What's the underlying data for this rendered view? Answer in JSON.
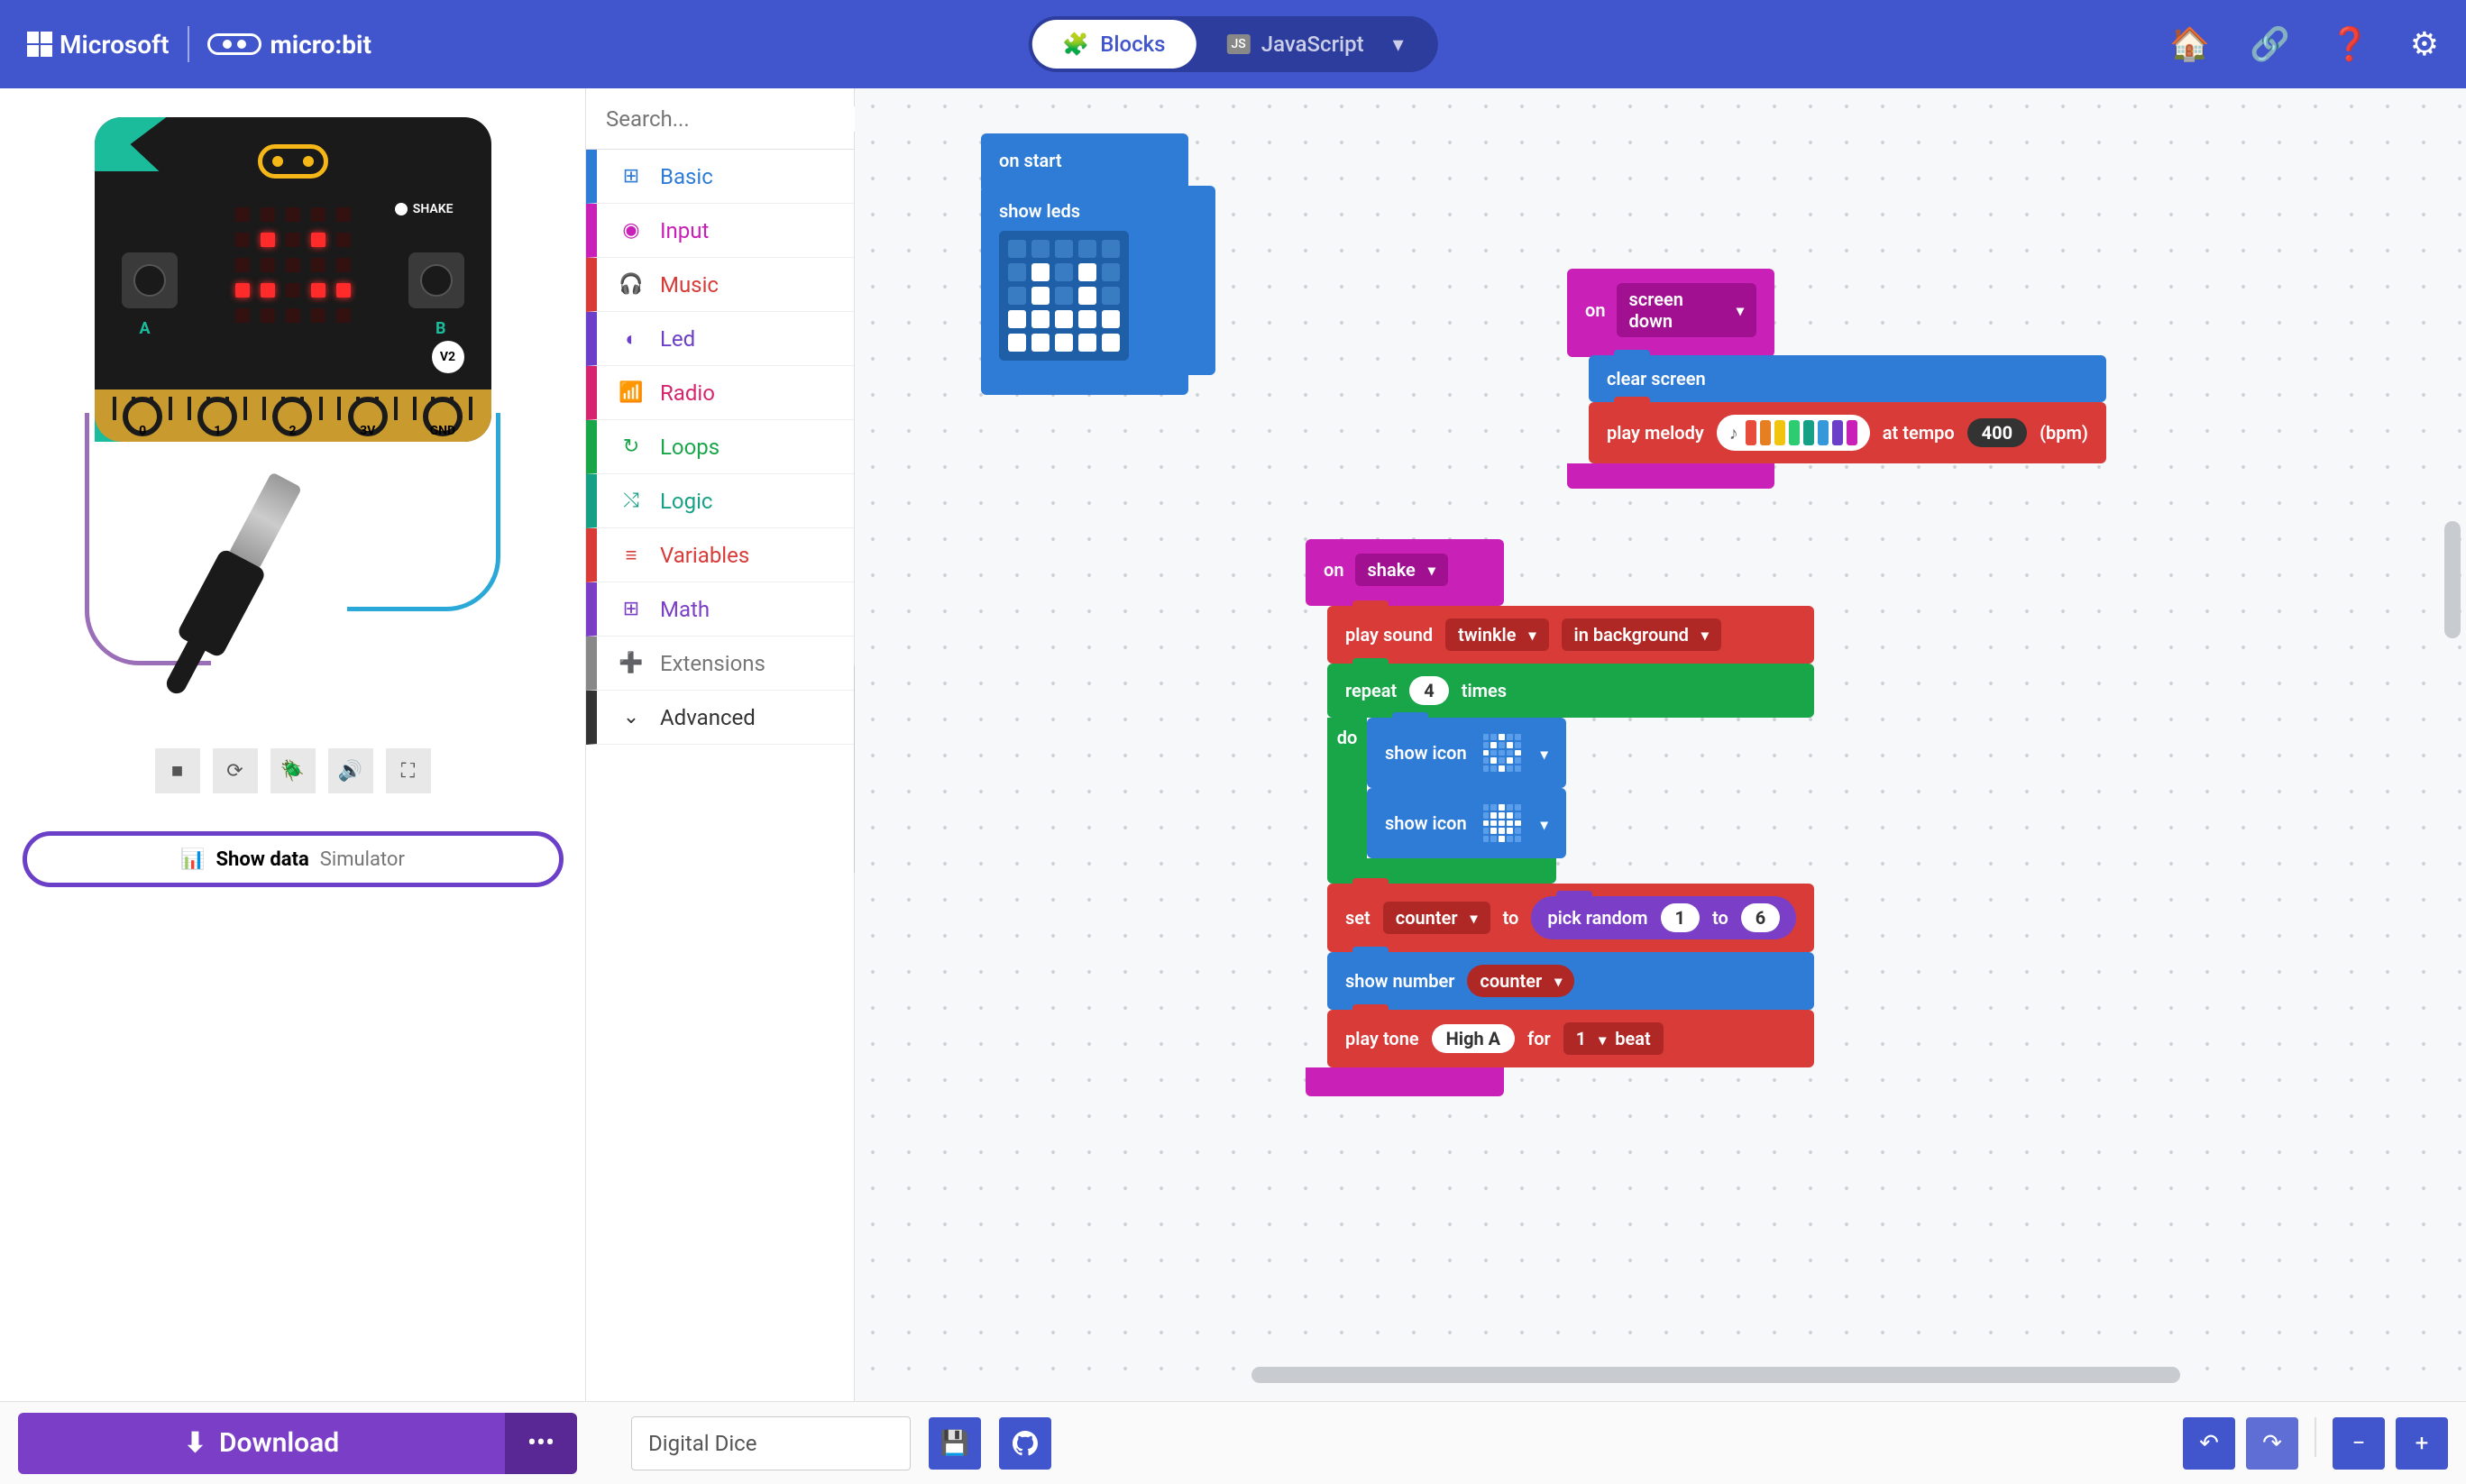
{
  "header": {
    "ms": "Microsoft",
    "mb": "micro:bit",
    "blocks": "Blocks",
    "js": "JavaScript"
  },
  "toolbox": {
    "search_placeholder": "Search...",
    "categories": [
      {
        "label": "Basic",
        "color": "#2e7cd6",
        "text": "#2e7cd6",
        "icon": "⊞"
      },
      {
        "label": "Input",
        "color": "#c920b7",
        "text": "#c920b7",
        "icon": "◉"
      },
      {
        "label": "Music",
        "color": "#d83b38",
        "text": "#d83b38",
        "icon": "🎧"
      },
      {
        "label": "Led",
        "color": "#6b3fc7",
        "text": "#6b3fc7",
        "icon": "◐"
      },
      {
        "label": "Radio",
        "color": "#d6246f",
        "text": "#d6246f",
        "icon": "📶"
      },
      {
        "label": "Loops",
        "color": "#19a649",
        "text": "#19a649",
        "icon": "↻"
      },
      {
        "label": "Logic",
        "color": "#16a085",
        "text": "#16a085",
        "icon": "⤭"
      },
      {
        "label": "Variables",
        "color": "#d83b38",
        "text": "#d83b38",
        "icon": "≡"
      },
      {
        "label": "Math",
        "color": "#7b3fc7",
        "text": "#7b3fc7",
        "icon": "⊞"
      },
      {
        "label": "Extensions",
        "color": "#888",
        "text": "#777",
        "icon": "➕"
      }
    ],
    "advanced": "Advanced"
  },
  "simulator": {
    "shake_label": "SHAKE",
    "v2": "V2",
    "pins": [
      "0",
      "1",
      "2",
      "3V",
      "GND"
    ],
    "show_data_bold": "Show data",
    "show_data_light": "Simulator"
  },
  "blocks": {
    "on_start": "on start",
    "show_leds": "show leds",
    "on_screen_down": "on",
    "screen_down": "screen down",
    "clear_screen": "clear screen",
    "play_melody": "play melody",
    "at_tempo": "at tempo",
    "tempo": "400",
    "bpm": "(bpm)",
    "on_shake_on": "on",
    "on_shake": "shake",
    "play_sound": "play sound",
    "twinkle": "twinkle",
    "in_background": "in background",
    "repeat": "repeat",
    "repeat_n": "4",
    "times": "times",
    "do": "do",
    "show_icon": "show icon",
    "set": "set",
    "counter": "counter",
    "to": "to",
    "pick_random": "pick random",
    "rand_lo": "1",
    "rand_to": "to",
    "rand_hi": "6",
    "show_number": "show number",
    "play_tone": "play tone",
    "tone": "High A",
    "for": "for",
    "beat": "1",
    "beat_lbl": "beat"
  },
  "footer": {
    "download": "Download",
    "project": "Digital Dice"
  },
  "melody_colors": [
    "#e74c3c",
    "#e67e22",
    "#f1c40f",
    "#2ecc71",
    "#16a085",
    "#3498db",
    "#6b3fc7",
    "#c920b7"
  ]
}
